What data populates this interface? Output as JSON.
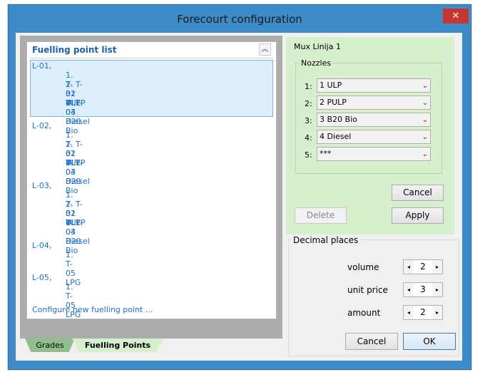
{
  "window": {
    "title": "Forecourt configuration",
    "close_glyph": "✕"
  },
  "fuelling_point_list": {
    "title": "Fuelling point list",
    "collapse_glyph": "︽",
    "points": [
      {
        "label": "L-01,",
        "nozzles": [
          "1. T-01 ULP",
          "2. T-02 PULP",
          "3. T-03 B20 Bio",
          "4. T-04 Diesel"
        ],
        "selected": true
      },
      {
        "label": "L-02,",
        "nozzles": [
          "1. T-01 ULP",
          "2. T-02 PULP",
          "3. T-03 B20 Bio",
          "4. T-04 Diesel"
        ],
        "selected": false
      },
      {
        "label": "L-03,",
        "nozzles": [
          "1. T-01 ULP",
          "2. T-02 PULP",
          "3. T-03 B20 Bio",
          "4. T-04 Diesel"
        ],
        "selected": false
      },
      {
        "label": "L-04,",
        "nozzles": [
          "1. T-05 LPG"
        ],
        "selected": false
      },
      {
        "label": "L-05,",
        "nozzles": [
          "1. T-05 LPG"
        ],
        "selected": false
      }
    ],
    "configure_link": "Configure new fuelling point ..."
  },
  "tabs": [
    {
      "label": "Grades",
      "active": false
    },
    {
      "label": "Fuelling Points",
      "active": true
    }
  ],
  "mux": {
    "title": "Mux Linija 1",
    "nozzles_label": "Nozzles",
    "nozzles": [
      {
        "label": "1:",
        "value": "1 ULP"
      },
      {
        "label": "2:",
        "value": "2 PULP"
      },
      {
        "label": "3:",
        "value": "3 B20 Bio"
      },
      {
        "label": "4:",
        "value": "4 Diesel"
      },
      {
        "label": "5:",
        "value": "***"
      }
    ],
    "cancel_label": "Cancel",
    "delete_label": "Delete",
    "apply_label": "Apply"
  },
  "decimal_places": {
    "title": "Decimal places",
    "rows": [
      {
        "label": "volume",
        "value": "2"
      },
      {
        "label": "unit price",
        "value": "3"
      },
      {
        "label": "amount",
        "value": "2"
      }
    ],
    "dec_glyph": "◂",
    "inc_glyph": "▸"
  },
  "footer": {
    "cancel_label": "Cancel",
    "ok_label": "OK"
  },
  "colors": {
    "accent": "#3d8bc8",
    "link": "#1f6fc6",
    "panel_green": "#d6efcc",
    "close_red": "#c7372f"
  }
}
